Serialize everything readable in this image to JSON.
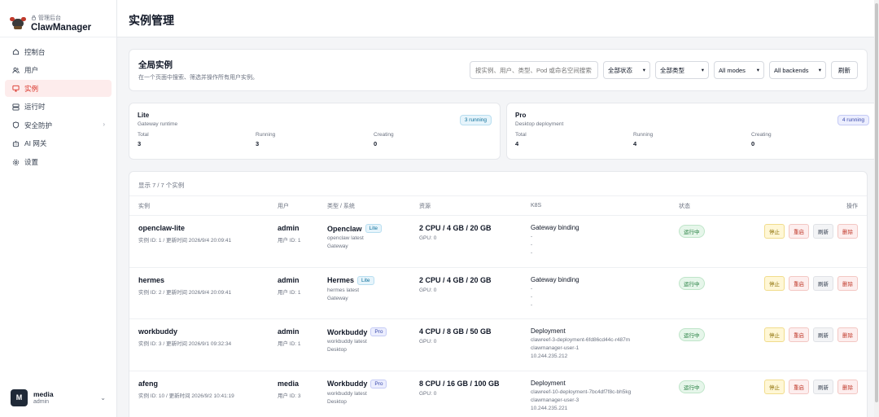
{
  "brand": {
    "subtitle": "管理后台",
    "title": "ClawManager"
  },
  "sidebar": {
    "items": [
      {
        "label": "控制台",
        "icon": "home-icon"
      },
      {
        "label": "用户",
        "icon": "users-icon"
      },
      {
        "label": "实例",
        "icon": "monitor-icon",
        "active": true
      },
      {
        "label": "运行时",
        "icon": "server-icon"
      },
      {
        "label": "安全防护",
        "icon": "shield-icon"
      },
      {
        "label": "AI 网关",
        "icon": "robot-icon"
      },
      {
        "label": "设置",
        "icon": "gear-icon"
      }
    ]
  },
  "user": {
    "initial": "M",
    "name": "media",
    "role": "admin"
  },
  "header": {
    "title": "实例管理"
  },
  "filter": {
    "title": "全局实例",
    "subtitle": "在一个页面中搜索、筛选并操作所有用户实例。",
    "search_placeholder": "按实例、用户、类型、Pod 或命名空间搜索",
    "status_select": "全部状态",
    "type_select": "全部类型",
    "mode_select": "All modes",
    "backend_select": "All backends",
    "refresh_label": "刷新"
  },
  "summary": [
    {
      "title": "Lite",
      "subtitle": "Gateway runtime",
      "badge": "3 running",
      "total_label": "Total",
      "total": "3",
      "running_label": "Running",
      "running": "3",
      "creating_label": "Creating",
      "creating": "0"
    },
    {
      "title": "Pro",
      "subtitle": "Desktop deployment",
      "badge": "4 running",
      "total_label": "Total",
      "total": "4",
      "running_label": "Running",
      "running": "4",
      "creating_label": "Creating",
      "creating": "0"
    }
  ],
  "table": {
    "count_text": "显示 7 / 7 个实例",
    "headers": {
      "instance": "实例",
      "user": "用户",
      "type": "类型 / 系统",
      "resources": "资源",
      "k8s": "K8S",
      "status": "状态",
      "actions": "操作"
    },
    "actions": {
      "stop": "停止",
      "restart": "重启",
      "refresh": "刷新",
      "delete": "删除"
    },
    "rows": [
      {
        "name": "openclaw-lite",
        "meta": "实例 ID: 1 / 更新时间 2026/9/4 20:09:41",
        "user": "admin",
        "user_id": "用户 ID: 1",
        "type": "Openclaw",
        "tag": "Lite",
        "type_sub1": "openclaw latest",
        "type_sub2": "Gateway",
        "resources": "2 CPU / 4 GB / 20 GB",
        "gpu": "GPU: 0",
        "k8s_main": "Gateway binding",
        "k8s_1": "-",
        "k8s_2": "-",
        "k8s_3": "-",
        "status": "运行中"
      },
      {
        "name": "hermes",
        "meta": "实例 ID: 2 / 更新时间 2026/9/4 20:09:41",
        "user": "admin",
        "user_id": "用户 ID: 1",
        "type": "Hermes",
        "tag": "Lite",
        "type_sub1": "hermes latest",
        "type_sub2": "Gateway",
        "resources": "2 CPU / 4 GB / 20 GB",
        "gpu": "GPU: 0",
        "k8s_main": "Gateway binding",
        "k8s_1": "-",
        "k8s_2": "-",
        "k8s_3": "-",
        "status": "运行中"
      },
      {
        "name": "workbuddy",
        "meta": "实例 ID: 3 / 更新时间 2026/9/1 09:32:34",
        "user": "admin",
        "user_id": "用户 ID: 1",
        "type": "Workbuddy",
        "tag": "Pro",
        "type_sub1": "workbuddy latest",
        "type_sub2": "Desktop",
        "resources": "4 CPU / 8 GB / 50 GB",
        "gpu": "GPU: 0",
        "k8s_main": "Deployment",
        "k8s_1": "clawreef-3-deployment-6fd86cd44c-r487m",
        "k8s_2": "clawmanager-user-1",
        "k8s_3": "10.244.235.212",
        "status": "运行中"
      },
      {
        "name": "afeng",
        "meta": "实例 ID: 10 / 更新时间 2026/9/2 10:41:19",
        "user": "media",
        "user_id": "用户 ID: 3",
        "type": "Workbuddy",
        "tag": "Pro",
        "type_sub1": "workbuddy latest",
        "type_sub2": "Desktop",
        "resources": "8 CPU / 16 GB / 100 GB",
        "gpu": "GPU: 0",
        "k8s_main": "Deployment",
        "k8s_1": "clawreef-10-deployment-7bc4df7f8c-bh5kg",
        "k8s_2": "clawmanager-user-3",
        "k8s_3": "10.244.235.221",
        "status": "运行中"
      }
    ]
  }
}
